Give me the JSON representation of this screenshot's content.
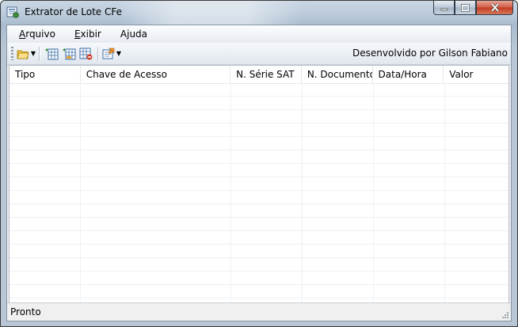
{
  "window": {
    "title": "Extrator de Lote CFe"
  },
  "menu": {
    "items": [
      "Arquivo",
      "Exibir",
      "Ajuda"
    ]
  },
  "toolbar": {
    "credit": "Desenvolvido por Gilson Fabiano"
  },
  "table": {
    "columns": [
      "Tipo",
      "Chave de Acesso",
      "N. Série SAT",
      "N. Documento",
      "Data/Hora",
      "Valor"
    ],
    "rows": []
  },
  "status": {
    "text": "Pronto"
  },
  "colors": {
    "title_gradient": "#bfcedd",
    "close_button": "#c23b20",
    "client_bg": "#f0f0f0"
  }
}
